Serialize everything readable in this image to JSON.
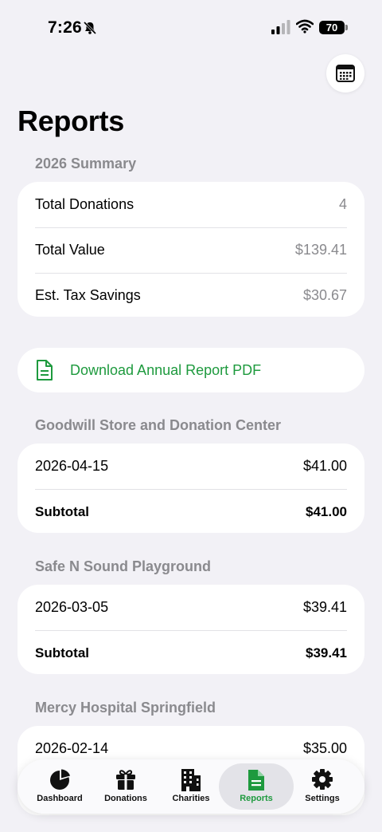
{
  "status": {
    "time": "7:26",
    "battery": "70"
  },
  "header": {
    "title": "Reports"
  },
  "summary": {
    "header": "2026 Summary",
    "rows": [
      {
        "label": "Total Donations",
        "value": "4"
      },
      {
        "label": "Total Value",
        "value": "$139.41"
      },
      {
        "label": "Est. Tax Savings",
        "value": "$30.67"
      }
    ]
  },
  "download": {
    "label": "Download Annual Report PDF"
  },
  "groups": [
    {
      "name": "Goodwill Store and Donation Center",
      "date": "2026-04-15",
      "amount": "$41.00",
      "subtotal_label": "Subtotal",
      "subtotal": "$41.00"
    },
    {
      "name": "Safe N Sound Playground",
      "date": "2026-03-05",
      "amount": "$39.41",
      "subtotal_label": "Subtotal",
      "subtotal": "$39.41"
    },
    {
      "name": "Mercy Hospital Springfield",
      "date": "2026-02-14",
      "amount": "$35.00"
    }
  ],
  "tabs": [
    {
      "label": "Dashboard",
      "icon": "pie-chart-icon"
    },
    {
      "label": "Donations",
      "icon": "gift-icon"
    },
    {
      "label": "Charities",
      "icon": "building-icon"
    },
    {
      "label": "Reports",
      "icon": "document-icon",
      "active": true
    },
    {
      "label": "Settings",
      "icon": "gear-icon"
    }
  ],
  "colors": {
    "accent": "#1e9a3e",
    "background": "#f2f1f6",
    "secondary_text": "#8a8a8e"
  }
}
